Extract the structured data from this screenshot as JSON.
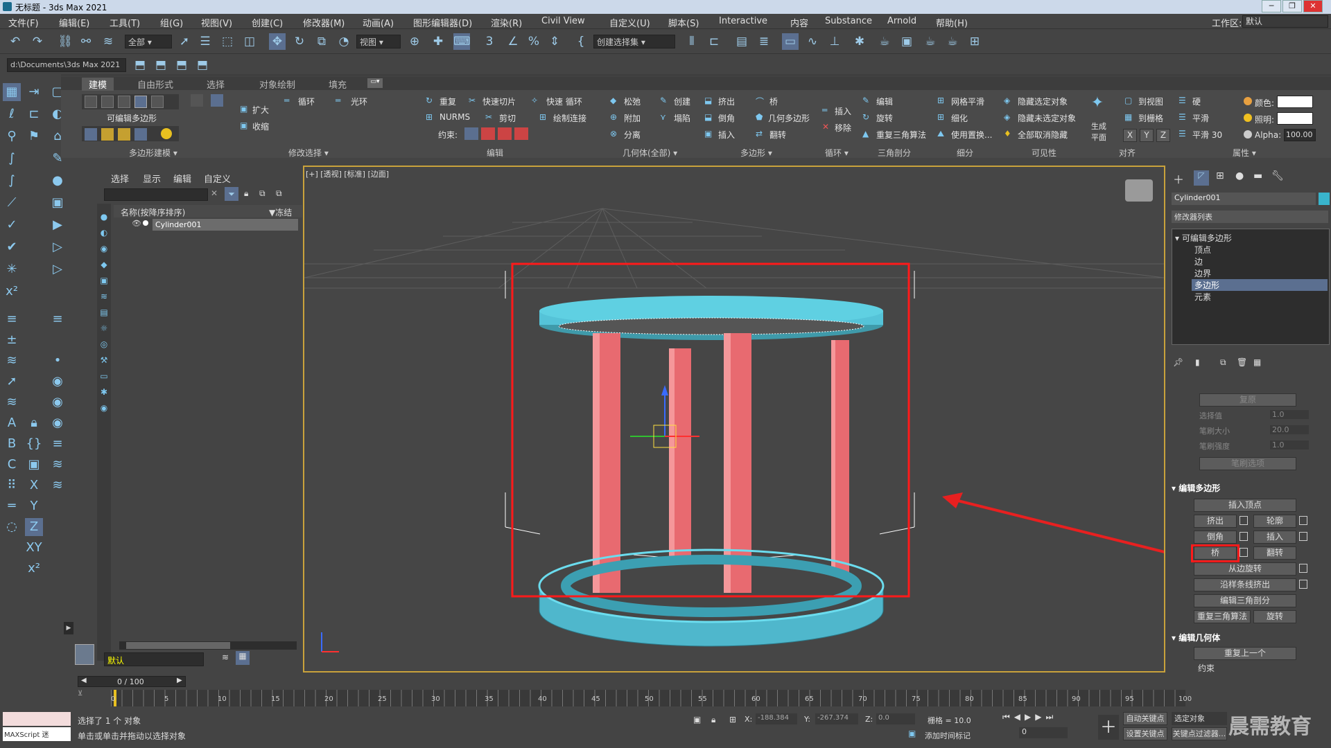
{
  "title": {
    "text": "无标题 - 3ds Max 2021"
  },
  "window_buttons": [
    "─",
    "❐",
    "✕"
  ],
  "menu": [
    "文件(F)",
    "编辑(E)",
    "工具(T)",
    "组(G)",
    "视图(V)",
    "创建(C)",
    "修改器(M)",
    "动画(A)",
    "图形编辑器(D)",
    "渲染(R)",
    "Civil View",
    "自定义(U)",
    "脚本(S)",
    "Interactive",
    "内容",
    "Substance",
    "Arnold",
    "帮助(H)"
  ],
  "workspace": {
    "label": "工作区:",
    "value": "默认"
  },
  "toolbar": {
    "filter_value": "全部",
    "refcoord_value": "视图",
    "selset_placeholder": "创建选择集"
  },
  "path": "d:\\Documents\\3ds Max 2021",
  "ribbon": {
    "tabs": [
      "建模",
      "自由形式",
      "选择",
      "对象绘制",
      "填充"
    ],
    "active_tab": "建模",
    "groups": [
      "多边形建模 ▾",
      "修改选择 ▾",
      "编辑",
      "几何体(全部) ▾",
      "多边形 ▾",
      "循环 ▾",
      "三角剖分",
      "细分",
      "可见性",
      "对齐",
      "属性 ▾"
    ],
    "poly_label": "可编辑多边形",
    "modsel": [
      "扩大",
      "收缩",
      "循环",
      "光环"
    ],
    "edit": [
      "重复",
      "快速切片",
      "快速 循环",
      "NURMS",
      "剪切",
      "绘制连接",
      "约束:"
    ],
    "geom": [
      "松弛",
      "创建",
      "附加",
      "塌陷",
      "分离"
    ],
    "poly": [
      "挤出",
      "桥",
      "倒角",
      "几何多边形",
      "插入",
      "翻转"
    ],
    "loop": [
      "插入",
      "移除"
    ],
    "tri": [
      "编辑",
      "旋转",
      "重复三角算法"
    ],
    "subdiv": [
      "网格平滑",
      "细化",
      "使用置换..."
    ],
    "vis": [
      "隐藏选定对象",
      "隐藏未选定对象",
      "全部取消隐藏"
    ],
    "align": [
      "生成平面",
      "到视图",
      "到栅格",
      "X",
      "Y",
      "Z"
    ],
    "props": [
      "硬",
      "平滑",
      "平滑 30",
      "颜色:",
      "照明:",
      "Alpha:",
      "100.00"
    ]
  },
  "scene_explorer": {
    "tabs": [
      "选择",
      "显示",
      "编辑",
      "自定义"
    ],
    "column": "名称(按降序排序)",
    "freeze": "▼冻结",
    "items": [
      "Cylinder001"
    ],
    "layer": "默认"
  },
  "viewport": {
    "label": "[+] [透视] [标准] [边面]"
  },
  "cmd_panel": {
    "object_name": "Cylinder001",
    "modifier_list": "修改器列表",
    "stack": [
      "可编辑多边形",
      "顶点",
      "边",
      "边界",
      "多边形",
      "元素"
    ],
    "selected_stack": "多边形",
    "soft": {
      "reset": "复原",
      "rows": [
        [
          "选择值",
          "1.0"
        ],
        [
          "笔刷大小",
          "20.0"
        ],
        [
          "笔刷强度",
          "1.0"
        ]
      ],
      "opts": "笔刷选项"
    },
    "edit_poly_title": "编辑多边形",
    "edit_poly_buttons": [
      "插入顶点",
      "挤出",
      "轮廓",
      "倒角",
      "插入",
      "桥",
      "翻转",
      "从边旋转",
      "沿样条线挤出",
      "编辑三角剖分",
      "重复三角算法",
      "旋转"
    ],
    "edit_geom_title": "编辑几何体",
    "edit_geom_buttons": [
      "重复上一个",
      "约束"
    ]
  },
  "timeline": {
    "frame": "0 / 100",
    "ticks": [
      "0",
      "5",
      "10",
      "15",
      "20",
      "25",
      "30",
      "35",
      "40",
      "45",
      "50",
      "55",
      "60",
      "65",
      "70",
      "75",
      "80",
      "85",
      "90",
      "95",
      "100"
    ]
  },
  "status": {
    "selected": "选择了 1 个 对象",
    "hint": "单击或单击并拖动以选择对象",
    "maxscript": "MAXScript 迷",
    "x_label": "X:",
    "x": "-188.384",
    "y_label": "Y:",
    "y": "-267.374",
    "z_label": "Z:",
    "z": "0.0",
    "grid": "栅格 = 10.0",
    "add_time_tag": "添加时间标记",
    "auto_key": "自动关键点",
    "selected_obj": "选定对象",
    "set_key": "设置关键点",
    "key_filter": "关键点过滤器...",
    "frame_field": "0",
    "watermark": "晨需教育"
  },
  "colors": {
    "accent": "#5b6f90",
    "highlight_red": "#ff1a1a",
    "ring": "#4fc3d6",
    "pillar": "#f07a7e"
  }
}
